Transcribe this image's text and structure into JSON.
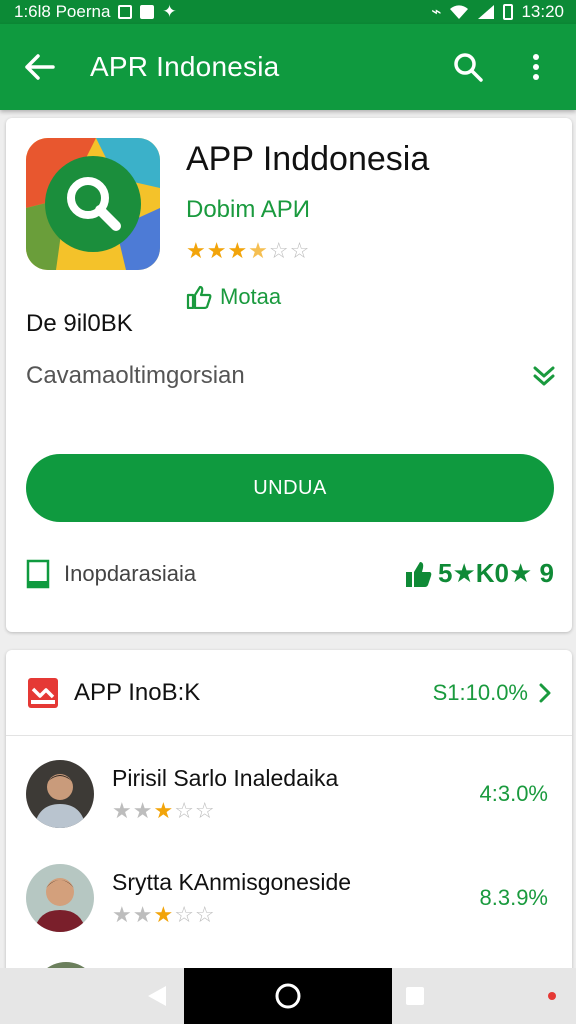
{
  "status_bar": {
    "left_text": "1:6l8 Poerna",
    "time": "13:20"
  },
  "app_bar": {
    "title": "APR Indonesia"
  },
  "app": {
    "name": "APP Inddonesia",
    "developer": "Dobim APИ",
    "rating": 3.5,
    "like_label": "Motaa",
    "size_label": "De 9il0BK",
    "category": "Cavamaoltimgorsian",
    "install_label": "UNDUA",
    "footer_left": "Inopdarasiaia",
    "footer_right": "5★K0★ 9"
  },
  "list": {
    "title": "APP InoB:K",
    "pct": "S1:10.0%",
    "items": [
      {
        "name": "Pirisil Sarlo Inaledaika",
        "pct": "4:3.0%",
        "stars": "★★★☆☆"
      },
      {
        "name": "Srytta KAnmisgoneside",
        "pct": "8.3.9%",
        "stars": "★★★☆☆"
      }
    ]
  },
  "colors": {
    "primary": "#0f9a3f",
    "status": "#0c8a36",
    "star": "#f2a40a",
    "accent_red": "#e53935"
  },
  "icons": [
    "back-arrow-icon",
    "search-icon",
    "more-vert-icon",
    "thumbs-up-icon",
    "chevron-down-icon",
    "tablet-icon",
    "chevron-right-icon",
    "nav-back-icon",
    "nav-home-icon",
    "nav-recents-icon"
  ]
}
